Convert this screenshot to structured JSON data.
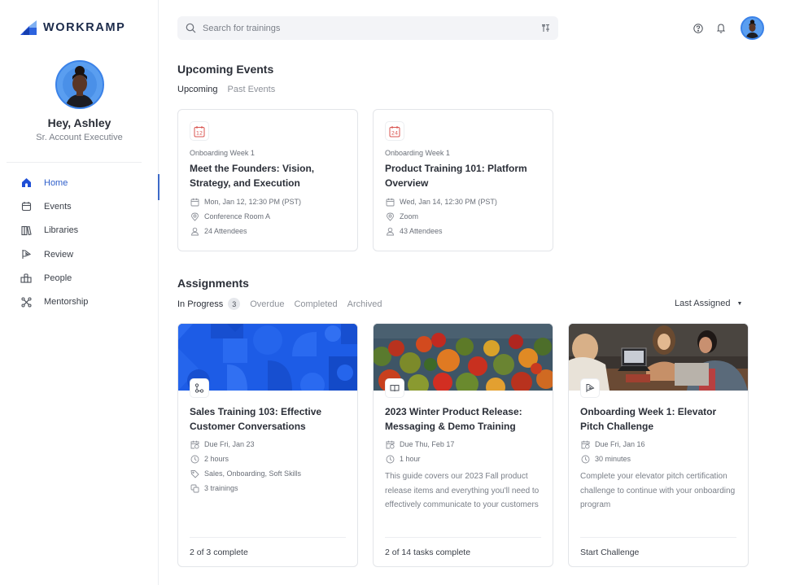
{
  "brand": {
    "name": "WORKRAMP"
  },
  "profile": {
    "greeting": "Hey, Ashley",
    "role": "Sr. Account Executive"
  },
  "sidebar": {
    "items": [
      {
        "label": "Home",
        "icon": "home-icon",
        "active": true
      },
      {
        "label": "Events",
        "icon": "calendar-icon"
      },
      {
        "label": "Libraries",
        "icon": "library-icon"
      },
      {
        "label": "Review",
        "icon": "flag-icon"
      },
      {
        "label": "People",
        "icon": "people-icon"
      },
      {
        "label": "Mentorship",
        "icon": "mentorship-icon"
      }
    ]
  },
  "search": {
    "placeholder": "Search for trainings",
    "value": ""
  },
  "topbar": {
    "help_icon": "help-icon",
    "bell_icon": "bell-icon"
  },
  "events": {
    "title": "Upcoming Events",
    "tabs": [
      {
        "label": "Upcoming",
        "active": true
      },
      {
        "label": "Past Events"
      }
    ],
    "cards": [
      {
        "day": "12",
        "group": "Onboarding Week 1",
        "title": "Meet the Founders: Vision, Strategy, and Execution",
        "date": "Mon, Jan 12, 12:30 PM (PST)",
        "location": "Conference Room A",
        "attendees": "24 Attendees"
      },
      {
        "day": "24",
        "group": "Onboarding Week 1",
        "title": "Product Training 101: Platform Overview",
        "date": "Wed, Jan 14, 12:30 PM (PST)",
        "location": "Zoom",
        "attendees": "43 Attendees"
      }
    ]
  },
  "assignments": {
    "title": "Assignments",
    "tabs": [
      {
        "label": "In Progress",
        "count": "3",
        "active": true
      },
      {
        "label": "Overdue"
      },
      {
        "label": "Completed"
      },
      {
        "label": "Archived"
      }
    ],
    "sort": {
      "label": "Last Assigned"
    },
    "cards": [
      {
        "type_icon": "path-icon",
        "title": "Sales Training 103: Effective Customer Conversations",
        "due": "Due Fri, Jan 23",
        "duration": "2 hours",
        "tags": "Sales, Onboarding, Soft Skills",
        "trainings": "3 trainings",
        "footer": "2 of 3 complete"
      },
      {
        "type_icon": "book-icon",
        "title": "2023 Winter Product Release: Messaging & Demo Training",
        "due": "Due Thu, Feb 17",
        "duration": "1 hour",
        "description": "This guide covers our 2023 Fall product release items and everything you'll need to effectively communicate to your customers",
        "footer": "2 of 14 tasks complete"
      },
      {
        "type_icon": "flag-icon",
        "title": "Onboarding Week 1: Elevator Pitch Challenge",
        "due": "Due Fri, Jan 16",
        "duration": "30 minutes",
        "description": "Complete your elevator pitch certification challenge to continue with your onboarding program",
        "footer": "Start Challenge"
      }
    ]
  },
  "colors": {
    "accent": "#1f4fd6",
    "event_icon": "#d9534f",
    "hero_blue": "#1d5ce6"
  }
}
